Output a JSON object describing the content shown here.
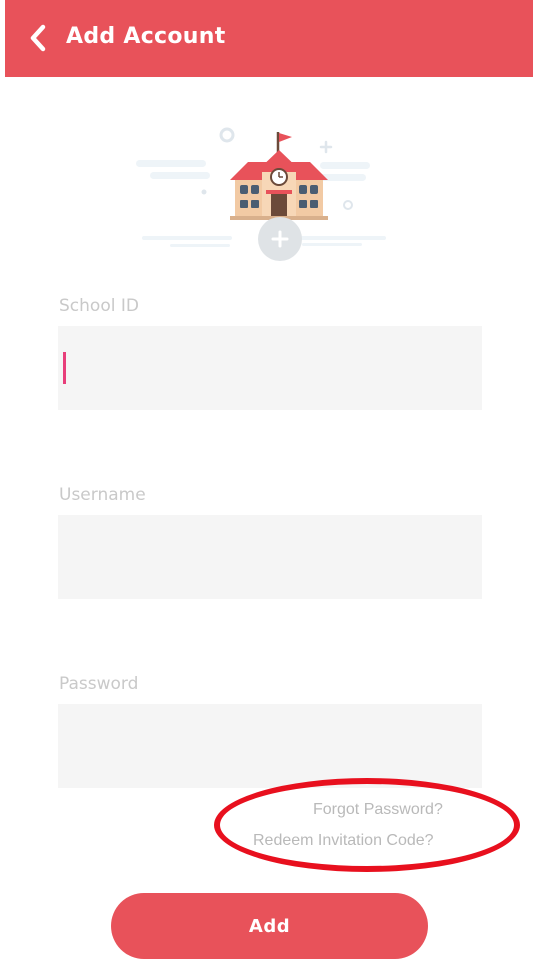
{
  "header": {
    "title": "Add Account",
    "back_icon": "chevron-left-icon"
  },
  "illustration": {
    "icon": "school-building-icon",
    "badge_icon": "plus-icon"
  },
  "form": {
    "school_id": {
      "label": "School ID",
      "value": ""
    },
    "username": {
      "label": "Username",
      "value": ""
    },
    "password": {
      "label": "Password",
      "value": ""
    }
  },
  "links": {
    "forgot_password": "Forgot Password?",
    "redeem_invitation": "Redeem Invitation Code?"
  },
  "actions": {
    "add_label": "Add"
  },
  "colors": {
    "accent": "#e8525a",
    "annotation": "#e8101e",
    "field_bg": "#f5f5f5",
    "label": "#c9c9c9",
    "cursor": "#e83e7a"
  }
}
